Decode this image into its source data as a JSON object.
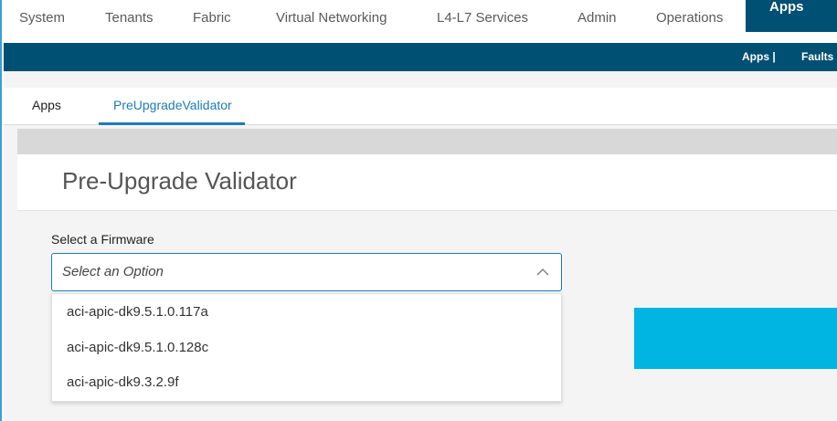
{
  "topnav": {
    "items": [
      "System",
      "Tenants",
      "Fabric",
      "Virtual Networking",
      "L4-L7 Services",
      "Admin",
      "Operations",
      "Apps"
    ],
    "active": "Apps"
  },
  "subnav": {
    "apps_label": "Apps |",
    "faults_label": "Faults"
  },
  "tabs": [
    "Apps",
    "PreUpgradeValidator"
  ],
  "active_tab": "PreUpgradeValidator",
  "page": {
    "title": "Pre-Upgrade Validator"
  },
  "firmware_select": {
    "label": "Select a Firmware",
    "placeholder": "Select an Option",
    "options": [
      "aci-apic-dk9.5.1.0.117a",
      "aci-apic-dk9.5.1.0.128c",
      "aci-apic-dk9.3.2.9f"
    ]
  },
  "colors": {
    "brand_dark": "#005073",
    "accent_blue": "#1e7bb8",
    "cyan_action": "#00b5e2"
  }
}
